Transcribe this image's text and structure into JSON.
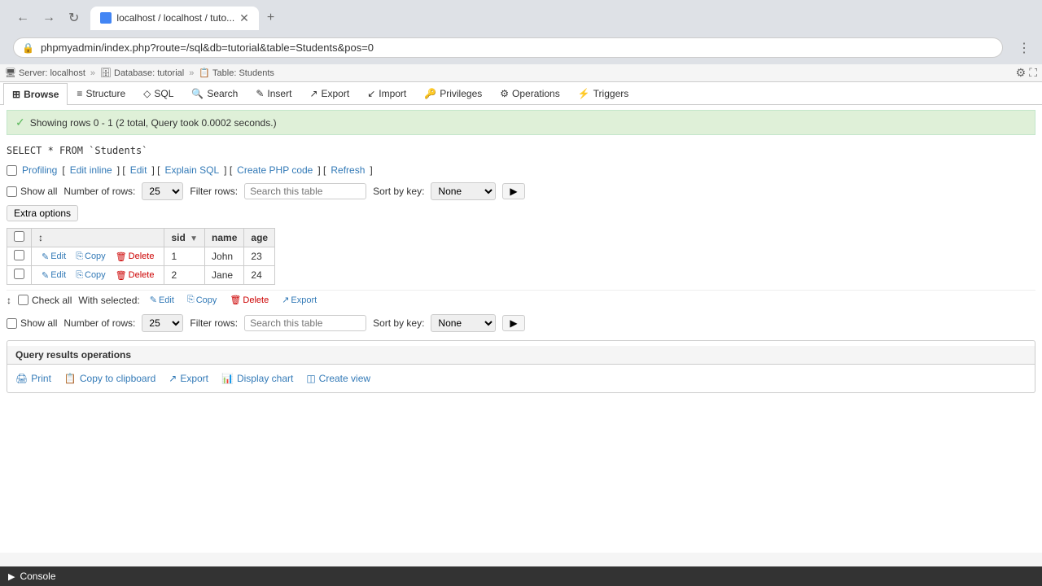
{
  "browser": {
    "tab_title": "localhost / localhost / tuto...",
    "tab_favicon": "🔷",
    "url": "phpmyadmin/index.php?route=/sql&db=tutorial&table=Students&pos=0",
    "new_tab_label": "+",
    "nav": {
      "back": "←",
      "forward": "→",
      "refresh": "↻"
    }
  },
  "topbar": {
    "server_icon": "🖥",
    "server_label": "Server: localhost",
    "sep1": "»",
    "db_icon": "🗄",
    "db_label": "Database: tutorial",
    "sep2": "»",
    "table_icon": "📋",
    "table_label": "Table: Students"
  },
  "tabs": [
    {
      "id": "browse",
      "label": "Browse",
      "icon": "⊞",
      "active": true
    },
    {
      "id": "structure",
      "label": "Structure",
      "icon": "≡",
      "active": false
    },
    {
      "id": "sql",
      "label": "SQL",
      "icon": "◇",
      "active": false
    },
    {
      "id": "search",
      "label": "Search",
      "icon": "🔍",
      "active": false
    },
    {
      "id": "insert",
      "label": "Insert",
      "icon": "✎",
      "active": false
    },
    {
      "id": "export",
      "label": "Export",
      "icon": "↗",
      "active": false
    },
    {
      "id": "import",
      "label": "Import",
      "icon": "↙",
      "active": false
    },
    {
      "id": "privileges",
      "label": "Privileges",
      "icon": "🔑",
      "active": false
    },
    {
      "id": "operations",
      "label": "Operations",
      "icon": "⚙",
      "active": false
    },
    {
      "id": "triggers",
      "label": "Triggers",
      "icon": "⚡",
      "active": false
    }
  ],
  "success_message": "Showing rows 0 - 1 (2 total, Query took 0.0002 seconds.)",
  "sql_query": "SELECT * FROM `Students`",
  "profiling": {
    "checkbox_label": "Profiling",
    "links": [
      "Edit inline",
      "Edit",
      "Explain SQL",
      "Create PHP code",
      "Refresh"
    ]
  },
  "table_controls_top": {
    "show_all_label": "Show all",
    "number_of_rows_label": "Number of rows:",
    "rows_value": "25",
    "filter_rows_label": "Filter rows:",
    "filter_placeholder": "Search this table",
    "sort_by_key_label": "Sort by key:",
    "sort_key_value": "None",
    "sort_options": [
      "None"
    ]
  },
  "extra_options_label": "Extra options",
  "table": {
    "columns": [
      {
        "id": "checkbox",
        "label": ""
      },
      {
        "id": "actions",
        "label": ""
      },
      {
        "id": "sid",
        "label": "sid"
      },
      {
        "id": "name",
        "label": "name"
      },
      {
        "id": "age",
        "label": "age"
      }
    ],
    "rows": [
      {
        "checked": false,
        "sid": "1",
        "name": "John",
        "age": "23"
      },
      {
        "checked": false,
        "sid": "2",
        "name": "Jane",
        "age": "24"
      }
    ]
  },
  "row_actions": {
    "edit": "Edit",
    "copy": "Copy",
    "delete": "Delete"
  },
  "selection_controls": {
    "arrow_icon": "↕",
    "check_all_label": "Check all",
    "with_selected_label": "With selected:",
    "edit_label": "Edit",
    "copy_label": "Copy",
    "delete_label": "Delete",
    "export_label": "Export"
  },
  "table_controls_bottom": {
    "show_all_label": "Show all",
    "number_of_rows_label": "Number of rows:",
    "rows_value": "25",
    "filter_rows_label": "Filter rows:",
    "filter_placeholder": "Search this table",
    "sort_by_key_label": "Sort by key:",
    "sort_key_value": "None"
  },
  "query_results_operations": {
    "title": "Query results operations",
    "actions": [
      {
        "id": "print",
        "icon": "🖨",
        "label": "Print"
      },
      {
        "id": "copy-to-clipboard",
        "icon": "📋",
        "label": "Copy to clipboard"
      },
      {
        "id": "export",
        "icon": "↗",
        "label": "Export"
      },
      {
        "id": "display-chart",
        "icon": "📊",
        "label": "Display chart"
      },
      {
        "id": "create-view",
        "icon": "◫",
        "label": "Create view"
      }
    ]
  },
  "console": {
    "icon": "▶",
    "label": "Console"
  }
}
